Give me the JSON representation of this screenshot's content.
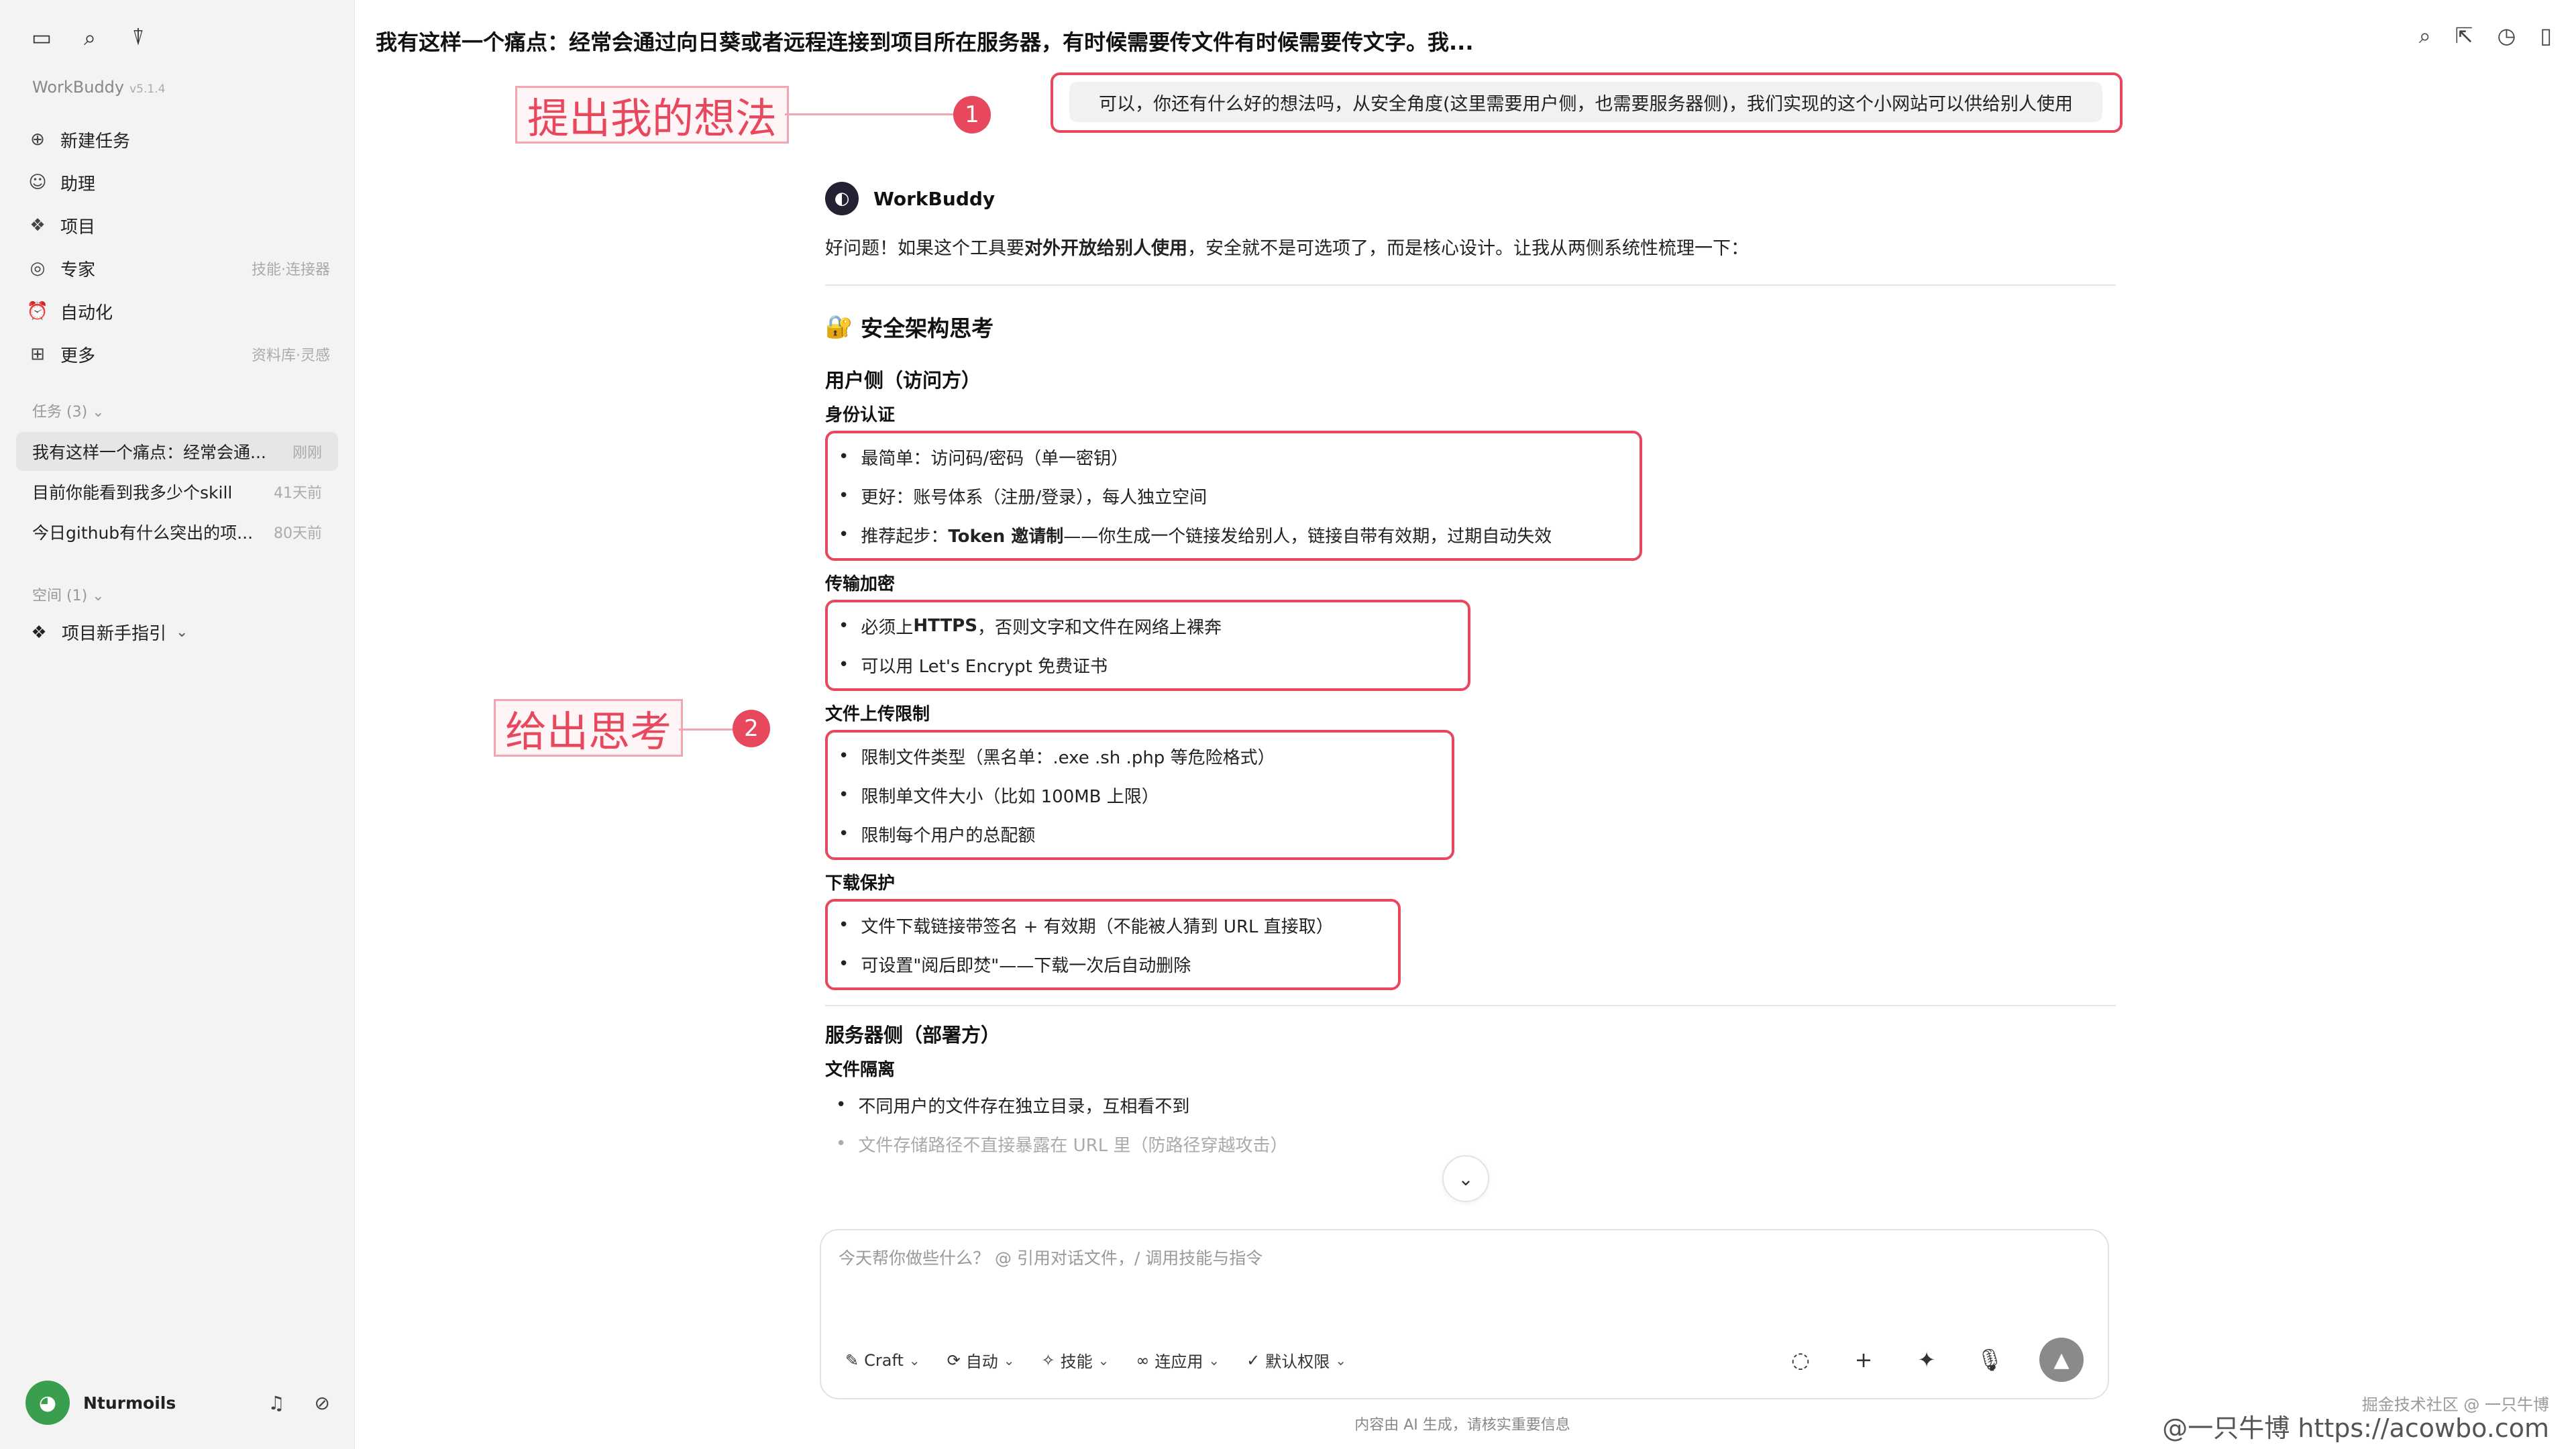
{
  "app": {
    "name": "WorkBuddy",
    "version": "v5.1.4"
  },
  "sidebar": {
    "top_icons": [
      "sidebar-toggle-icon",
      "search-icon",
      "filter-icon"
    ],
    "nav": [
      {
        "label": "新建任务",
        "icon": "new-task-icon",
        "hint": ""
      },
      {
        "label": "助理",
        "icon": "assistant-icon",
        "hint": ""
      },
      {
        "label": "项目",
        "icon": "project-icon",
        "hint": ""
      },
      {
        "label": "专家",
        "icon": "expert-icon",
        "hint": "技能·连接器"
      },
      {
        "label": "自动化",
        "icon": "automation-icon",
        "hint": ""
      },
      {
        "label": "更多",
        "icon": "more-icon",
        "hint": "资料库·灵感"
      }
    ],
    "tasks_section": "任务 (3)",
    "tasks": [
      {
        "title": "我有这样一个痛点：经常会通...",
        "time": "刚刚",
        "active": true
      },
      {
        "title": "目前你能看到我多少个skill",
        "time": "41天前",
        "active": false
      },
      {
        "title": "今日github有什么突出的项...",
        "time": "80天前",
        "active": false
      }
    ],
    "space_section": "空间 (1)",
    "space_item": "项目新手指引",
    "user": {
      "name": "Nturmoils"
    }
  },
  "header": {
    "title": "我有这样一个痛点：经常会通过向日葵或者远程连接到项目所在服务器，有时候需要传文件有时候需要传文字。我..."
  },
  "user_message": "可以，你还有什么好的想法吗，从安全角度(这里需要用户侧，也需要服务器侧)，我们实现的这个小网站可以供给别人使用",
  "annotations": [
    {
      "label": "提出我的想法",
      "number": "1"
    },
    {
      "label": "给出思考",
      "number": "2"
    }
  ],
  "assistant": {
    "name": "WorkBuddy",
    "intro_pre": "好问题！如果这个工具要",
    "intro_bold": "对外开放给别人使用",
    "intro_post": "，安全就不是可选项了，而是核心设计。让我从两侧系统性梳理一下：",
    "heading_icon": "🔐",
    "heading": "安全架构思考",
    "user_side": {
      "title": "用户侧（访问方）",
      "auth": {
        "title": "身份认证",
        "items": [
          "最简单：访问码/密码（单一密钥）",
          "更好：账号体系（注册/登录），每人独立空间"
        ],
        "rec_pre": "推荐起步：",
        "rec_bold": "Token 邀请制",
        "rec_post": "——你生成一个链接发给别人，链接自带有效期，过期自动失效"
      },
      "transport": {
        "title": "传输加密",
        "https_pre": "必须上 ",
        "https_bold": "HTTPS",
        "https_post": "，否则文字和文件在网络上裸奔",
        "item2": "可以用 Let's Encrypt 免费证书"
      },
      "upload": {
        "title": "文件上传限制",
        "items": [
          "限制文件类型（黑名单：.exe .sh .php 等危险格式）",
          "限制单文件大小（比如 100MB 上限）",
          "限制每个用户的总配额"
        ]
      },
      "download": {
        "title": "下载保护",
        "items": [
          "文件下载链接带签名 + 有效期（不能被人猜到 URL 直接取）",
          "可设置\"阅后即焚\"——下载一次后自动删除"
        ]
      }
    },
    "server_side": {
      "title": "服务器侧（部署方）",
      "isolation": {
        "title": "文件隔离",
        "items": [
          "不同用户的文件存在独立目录，互相看不到",
          "文件存储路径不直接暴露在 URL 里（防路径穿越攻击）"
        ]
      }
    }
  },
  "composer": {
    "placeholder": "今天帮你做些什么？ @ 引用对话文件，/ 调用技能与指令",
    "tools": [
      "Craft",
      "自动",
      "技能",
      "连应用",
      "默认权限"
    ]
  },
  "disclaimer": "内容由 AI 生成，请核实重要信息",
  "watermark": {
    "line1": "掘金技术社区 @ 一只牛博",
    "line2": "@一只牛博 https://acowbo.com"
  }
}
